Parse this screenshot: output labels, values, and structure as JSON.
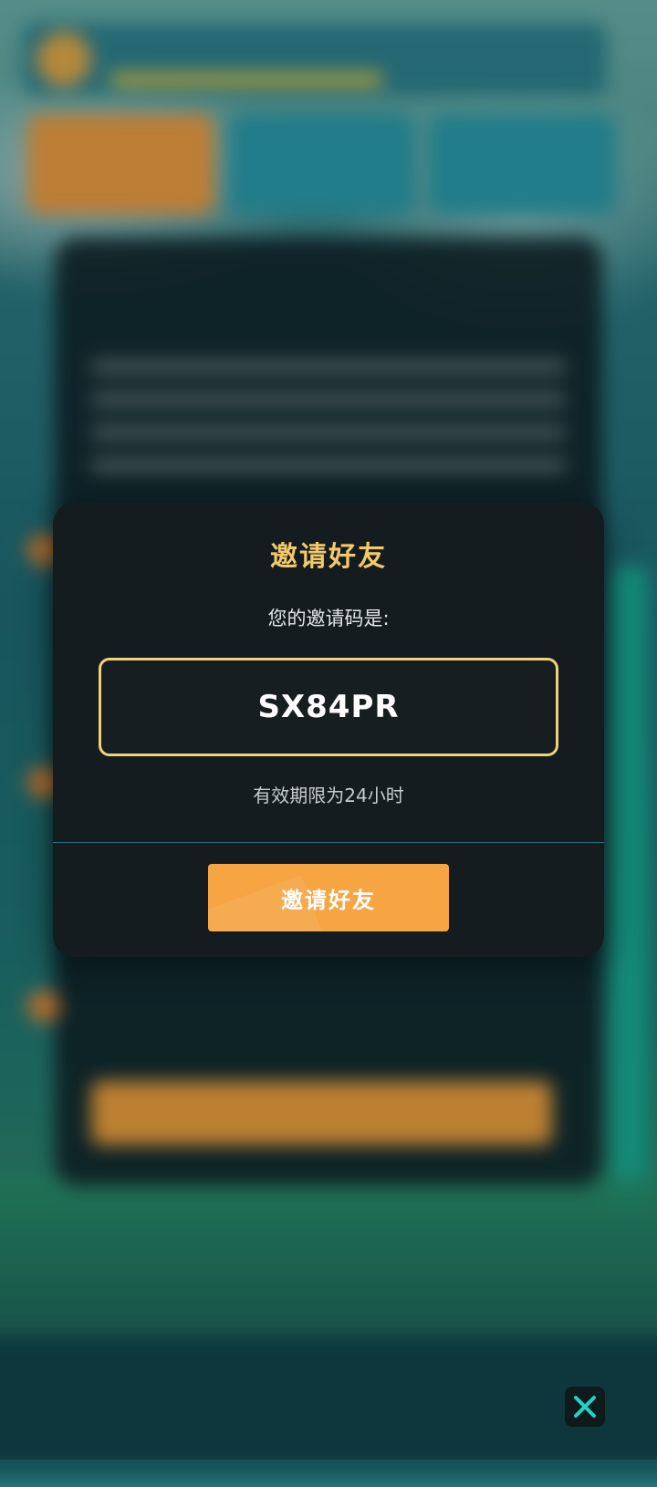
{
  "dialog": {
    "title": "邀请好友",
    "code_label": "您的邀请码是:",
    "invite_code": "SX84PR",
    "validity_note": "有效期限为24小时",
    "invite_button_label": "邀请好友"
  },
  "colors": {
    "title": "#f2c96b",
    "code_border": "#f0d27a",
    "button": "#f7a443",
    "dialog_bg": "#141c1f",
    "divider": "#2d6f7c"
  },
  "icons": {
    "close": "close-icon"
  }
}
